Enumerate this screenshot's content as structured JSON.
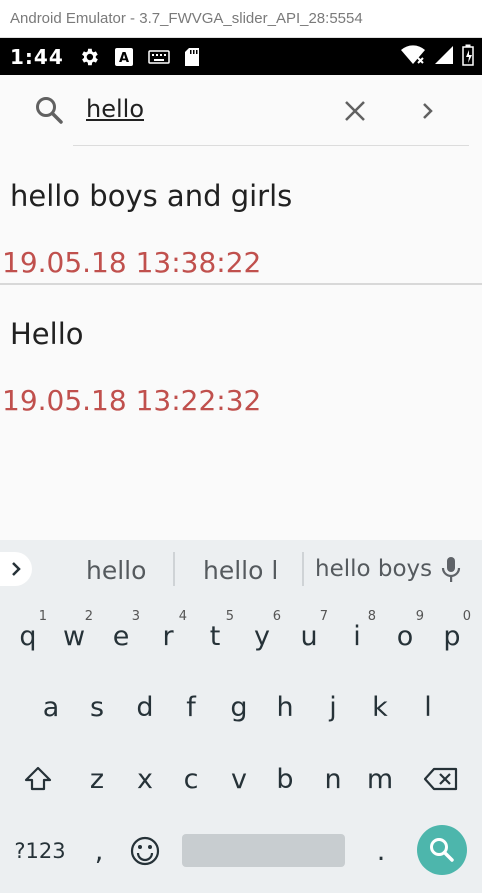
{
  "window": {
    "title": "Android Emulator - 3.7_FWVGA_slider_API_28:5554"
  },
  "status_bar": {
    "time": "1:44"
  },
  "search": {
    "query": "hello"
  },
  "results": [
    {
      "title": "hello boys and girls",
      "date": "19.05.18 13:38:22"
    },
    {
      "title": "Hello",
      "date": "19.05.18 13:22:32"
    }
  ],
  "colors": {
    "date": "#c0504d",
    "accent": "#4db6ac",
    "keyboard_bg": "#eceff1"
  },
  "keyboard": {
    "suggestions": [
      "hello",
      "hello l",
      "hello boys"
    ],
    "row1": [
      {
        "key": "q",
        "hint": "1"
      },
      {
        "key": "w",
        "hint": "2"
      },
      {
        "key": "e",
        "hint": "3"
      },
      {
        "key": "r",
        "hint": "4"
      },
      {
        "key": "t",
        "hint": "5"
      },
      {
        "key": "y",
        "hint": "6"
      },
      {
        "key": "u",
        "hint": "7"
      },
      {
        "key": "i",
        "hint": "8"
      },
      {
        "key": "o",
        "hint": "9"
      },
      {
        "key": "p",
        "hint": "0"
      }
    ],
    "row2": [
      "a",
      "s",
      "d",
      "f",
      "g",
      "h",
      "j",
      "k",
      "l"
    ],
    "row3": [
      "z",
      "x",
      "c",
      "v",
      "b",
      "n",
      "m"
    ],
    "symbols_label": "?123",
    "comma": ",",
    "period": "."
  },
  "icons": [
    "settings-icon",
    "keyboard-a-icon",
    "keyboard-icon",
    "sd-card-icon",
    "wifi-icon",
    "signal-icon",
    "battery-icon",
    "search-icon",
    "close-icon",
    "chevron-right-icon",
    "mic-icon",
    "shift-icon",
    "backspace-icon",
    "emoji-icon"
  ]
}
